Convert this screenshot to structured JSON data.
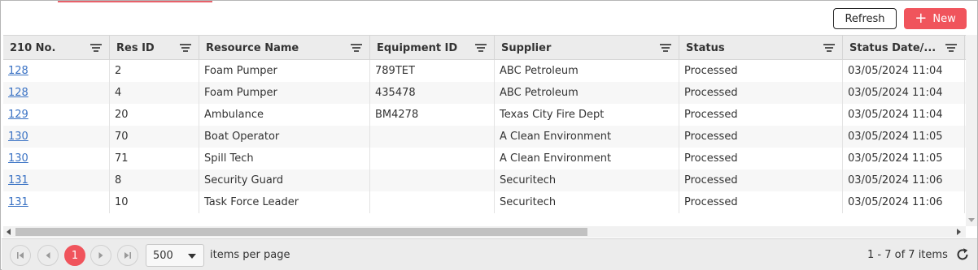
{
  "toolbar": {
    "refresh_label": "Refresh",
    "new_label": "New",
    "accent_color": "#f0545c"
  },
  "grid": {
    "columns": [
      {
        "label": "210 No."
      },
      {
        "label": "Res ID"
      },
      {
        "label": "Resource Name"
      },
      {
        "label": "Equipment ID"
      },
      {
        "label": "Supplier"
      },
      {
        "label": "Status"
      },
      {
        "label": "Status Date/..."
      }
    ],
    "rows": [
      {
        "no": "128",
        "res_id": "2",
        "resource_name": "Foam Pumper",
        "equipment_id": "789TET",
        "supplier": "ABC Petroleum",
        "status": "Processed",
        "status_date": "03/05/2024 11:04"
      },
      {
        "no": "128",
        "res_id": "4",
        "resource_name": "Foam Pumper",
        "equipment_id": "435478",
        "supplier": "ABC Petroleum",
        "status": "Processed",
        "status_date": "03/05/2024 11:04"
      },
      {
        "no": "129",
        "res_id": "20",
        "resource_name": "Ambulance",
        "equipment_id": "BM4278",
        "supplier": "Texas City Fire Dept",
        "status": "Processed",
        "status_date": "03/05/2024 11:04"
      },
      {
        "no": "130",
        "res_id": "70",
        "resource_name": "Boat Operator",
        "equipment_id": "",
        "supplier": "A Clean Environment",
        "status": "Processed",
        "status_date": "03/05/2024 11:05"
      },
      {
        "no": "130",
        "res_id": "71",
        "resource_name": "Spill Tech",
        "equipment_id": "",
        "supplier": "A Clean Environment",
        "status": "Processed",
        "status_date": "03/05/2024 11:05"
      },
      {
        "no": "131",
        "res_id": "8",
        "resource_name": "Security Guard",
        "equipment_id": "",
        "supplier": "Securitech",
        "status": "Processed",
        "status_date": "03/05/2024 11:06"
      },
      {
        "no": "131",
        "res_id": "10",
        "resource_name": "Task Force Leader",
        "equipment_id": "",
        "supplier": "Securitech",
        "status": "Processed",
        "status_date": "03/05/2024 11:06"
      }
    ]
  },
  "pager": {
    "current_page": "1",
    "page_size": "500",
    "items_per_page_label": "items per page",
    "items_info": "1 - 7 of 7 items"
  }
}
